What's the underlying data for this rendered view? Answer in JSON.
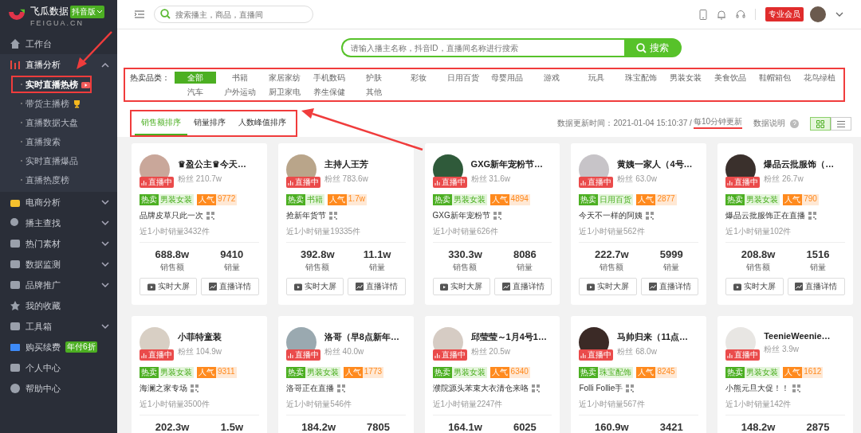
{
  "brand": {
    "name": "飞瓜数据",
    "edition": "抖音版",
    "domain": "FEIGUA.CN"
  },
  "sidebar": {
    "items": [
      {
        "label": "工作台"
      },
      {
        "label": "直播分析",
        "expanded": true,
        "children": [
          {
            "label": "实时直播热榜",
            "selected": true
          },
          {
            "label": "带货主播榜",
            "selected": false
          },
          {
            "label": "直播数据大盘",
            "selected": false
          },
          {
            "label": "直播搜索",
            "selected": false
          },
          {
            "label": "实时直播爆品",
            "selected": false
          },
          {
            "label": "直播热度榜",
            "selected": false
          }
        ]
      },
      {
        "label": "电商分析",
        "expanded": false
      },
      {
        "label": "播主查找",
        "expanded": false
      },
      {
        "label": "热门素材",
        "expanded": false
      },
      {
        "label": "数据监测",
        "expanded": false
      },
      {
        "label": "品牌推广",
        "expanded": false
      },
      {
        "label": "我的收藏"
      },
      {
        "label": "工具箱",
        "expanded": false
      },
      {
        "label": "购买续费",
        "badge": "年付6折"
      },
      {
        "label": "个人中心"
      },
      {
        "label": "帮助中心"
      }
    ]
  },
  "header": {
    "search_placeholder": "搜索播主，商品，直播间",
    "member_badge": "专业会员"
  },
  "search": {
    "placeholder": "请输入播主名称，抖音ID，直播间名称进行搜索",
    "button": "搜索"
  },
  "categories": {
    "label": "热卖品类：",
    "items": [
      {
        "label": "全部",
        "selected": true
      },
      {
        "label": "书籍",
        "selected": false
      },
      {
        "label": "家居家纺",
        "selected": false
      },
      {
        "label": "手机数码",
        "selected": false
      },
      {
        "label": "护肤",
        "selected": false
      },
      {
        "label": "彩妆",
        "selected": false
      },
      {
        "label": "日用百货",
        "selected": false
      },
      {
        "label": "母婴用品",
        "selected": false
      },
      {
        "label": "游戏",
        "selected": false
      },
      {
        "label": "玩具",
        "selected": false
      },
      {
        "label": "珠宝配饰",
        "selected": false
      },
      {
        "label": "男装女装",
        "selected": false
      },
      {
        "label": "美食饮品",
        "selected": false
      },
      {
        "label": "鞋帽箱包",
        "selected": false
      },
      {
        "label": "花鸟绿植",
        "selected": false
      },
      {
        "label": "汽车",
        "selected": false
      },
      {
        "label": "户外运动",
        "selected": false
      },
      {
        "label": "厨卫家电",
        "selected": false
      },
      {
        "label": "养生保健",
        "selected": false
      },
      {
        "label": "其他",
        "selected": false
      }
    ]
  },
  "sort_tabs": [
    {
      "label": "销售额排序",
      "selected": true
    },
    {
      "label": "销量排序",
      "selected": false
    },
    {
      "label": "人数峰值排序",
      "selected": false
    }
  ],
  "update": {
    "time": "数据更新时间：2021-01-04 15:10:37 /",
    "interval": "每10分钟更新",
    "help": "数据说明"
  },
  "view_modes": [
    {
      "kind": "grid",
      "selected": true
    },
    {
      "kind": "list",
      "selected": false
    }
  ],
  "cards": [
    {
      "name": "♛盈公主♛今天…",
      "fans": "粉丝 210.7w",
      "live": "直播中",
      "hot": "热卖",
      "category": "男装女装",
      "pop": "人气",
      "popularity": "9772",
      "title": "品牌皮草只此一次",
      "recent": "近1小时销量3432件",
      "sales": "688.8w",
      "sales_label": "销售额",
      "volume": "9410",
      "volume_label": "销量",
      "buttons": [
        "实时大屏",
        "直播详情"
      ]
    },
    {
      "name": "主持人王芳",
      "fans": "粉丝 783.6w",
      "live": "直播中",
      "hot": "热卖",
      "category": "书籍",
      "pop": "人气",
      "popularity": "1.7w",
      "title": "抢新年货节",
      "recent": "近1小时销量19335件",
      "sales": "392.8w",
      "sales_label": "销售额",
      "volume": "11.1w",
      "volume_label": "销量",
      "buttons": [
        "实时大屏",
        "直播详情"
      ]
    },
    {
      "name": "GXG新年宠粉节…",
      "fans": "粉丝 31.6w",
      "live": "直播中",
      "hot": "热卖",
      "category": "男装女装",
      "pop": "人气",
      "popularity": "4894",
      "title": "GXG新年宠粉节",
      "recent": "近1小时销量626件",
      "sales": "330.3w",
      "sales_label": "销售额",
      "volume": "8086",
      "volume_label": "销量",
      "buttons": [
        "实时大屏",
        "直播详情"
      ]
    },
    {
      "name": "黄姨一家人（4号…",
      "fans": "粉丝 63.0w",
      "live": "直播中",
      "hot": "热卖",
      "category": "日用百货",
      "pop": "人气",
      "popularity": "2877",
      "title": "今天不一样的阿姨",
      "recent": "近1小时销量562件",
      "sales": "222.7w",
      "sales_label": "销售额",
      "volume": "5999",
      "volume_label": "销量",
      "buttons": [
        "实时大屏",
        "直播详情"
      ]
    },
    {
      "name": "爆品云批服饰（…",
      "fans": "粉丝 26.7w",
      "live": "直播中",
      "hot": "热卖",
      "category": "男装女装",
      "pop": "人气",
      "popularity": "790",
      "title": "爆品云批服饰正在直播",
      "recent": "近1小时销量102件",
      "sales": "208.8w",
      "sales_label": "销售额",
      "volume": "1516",
      "volume_label": "销量",
      "buttons": [
        "实时大屏",
        "直播详情"
      ]
    },
    {
      "name": "小菲特童装",
      "fans": "粉丝 104.9w",
      "live": "直播中",
      "hot": "热卖",
      "category": "男装女装",
      "pop": "人气",
      "popularity": "9311",
      "title": "海澜之家专场",
      "recent": "近1小时销量3500件",
      "sales": "202.3w",
      "volume": "1.5w"
    },
    {
      "name": "洛哥（早8点新年…",
      "fans": "粉丝 40.0w",
      "live": "直播中",
      "hot": "热卖",
      "category": "男装女装",
      "pop": "人气",
      "popularity": "1773",
      "title": "洛哥正在直播",
      "recent": "近1小时销量546件",
      "sales": "184.2w",
      "volume": "7805"
    },
    {
      "name": "邱莹莹～1月4号1…",
      "fans": "粉丝 20.5w",
      "live": "直播中",
      "hot": "热卖",
      "category": "男装女装",
      "pop": "人气",
      "popularity": "6340",
      "title": "濮院源头苯束大衣清仓来咯",
      "recent": "近1小时销量2247件",
      "sales": "164.1w",
      "volume": "6025"
    },
    {
      "name": "马帅归来（11点…",
      "fans": "粉丝 68.0w",
      "live": "直播中",
      "hot": "热卖",
      "category": "珠宝配饰",
      "pop": "人气",
      "popularity": "8245",
      "title": "Folli Follie手",
      "recent": "近1小时销量567件",
      "sales": "160.9w",
      "volume": "3421"
    },
    {
      "name": "TeenieWeenie…",
      "fans": "粉丝 3.9w",
      "live": "直播中",
      "hot": "热卖",
      "category": "男装女装",
      "pop": "人气",
      "popularity": "1612",
      "title": "小熊元旦大促！！",
      "recent": "近1小时销量142件",
      "sales": "148.2w",
      "volume": "2875"
    }
  ]
}
